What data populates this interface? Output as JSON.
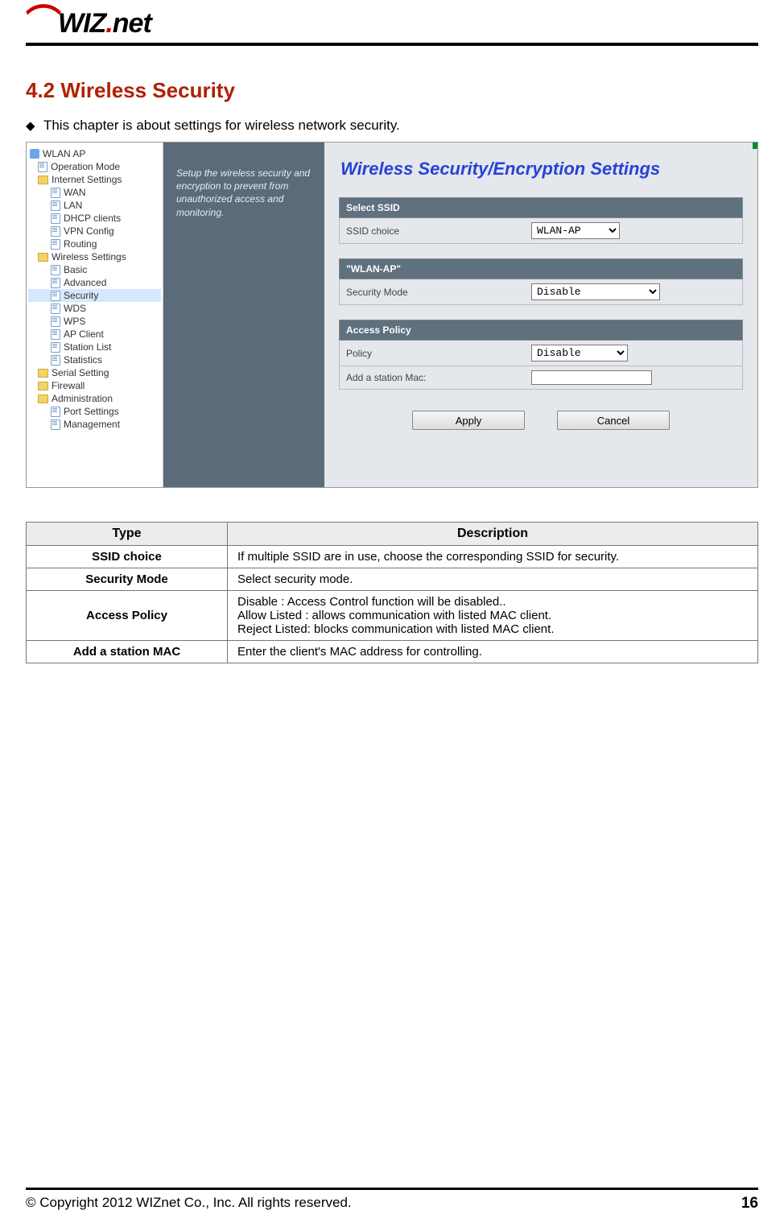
{
  "header": {
    "logo_text_1": "WIZ",
    "logo_text_2": "net"
  },
  "section": {
    "number_title": "4.2  Wireless Security",
    "intro": "This chapter is about settings for wireless network security."
  },
  "screenshot": {
    "tree": {
      "root": "WLAN AP",
      "items": [
        {
          "label": "Operation Mode",
          "indent": 0,
          "icon": "page"
        },
        {
          "label": "Internet Settings",
          "indent": 0,
          "icon": "folder"
        },
        {
          "label": "WAN",
          "indent": 1,
          "icon": "page"
        },
        {
          "label": "LAN",
          "indent": 1,
          "icon": "page"
        },
        {
          "label": "DHCP clients",
          "indent": 1,
          "icon": "page"
        },
        {
          "label": "VPN Config",
          "indent": 1,
          "icon": "page"
        },
        {
          "label": "Routing",
          "indent": 1,
          "icon": "page"
        },
        {
          "label": "Wireless Settings",
          "indent": 0,
          "icon": "folder"
        },
        {
          "label": "Basic",
          "indent": 1,
          "icon": "page"
        },
        {
          "label": "Advanced",
          "indent": 1,
          "icon": "page"
        },
        {
          "label": "Security",
          "indent": 1,
          "icon": "page",
          "selected": true
        },
        {
          "label": "WDS",
          "indent": 1,
          "icon": "page"
        },
        {
          "label": "WPS",
          "indent": 1,
          "icon": "page"
        },
        {
          "label": "AP Client",
          "indent": 1,
          "icon": "page"
        },
        {
          "label": "Station List",
          "indent": 1,
          "icon": "page"
        },
        {
          "label": "Statistics",
          "indent": 1,
          "icon": "page"
        },
        {
          "label": "Serial Setting",
          "indent": 0,
          "icon": "folder"
        },
        {
          "label": "Firewall",
          "indent": 0,
          "icon": "folder"
        },
        {
          "label": "Administration",
          "indent": 0,
          "icon": "folder"
        },
        {
          "label": "Port Settings",
          "indent": 1,
          "icon": "page"
        },
        {
          "label": "Management",
          "indent": 1,
          "icon": "page"
        }
      ]
    },
    "side_desc": "Setup the wireless security and encryption to prevent from unauthorized access and monitoring.",
    "panel": {
      "title": "Wireless Security/Encryption Settings",
      "section1_head": "Select SSID",
      "ssid_label": "SSID choice",
      "ssid_value": "WLAN-AP",
      "section2_head": "\"WLAN-AP\"",
      "secmode_label": "Security Mode",
      "secmode_value": "Disable",
      "section3_head": "Access Policy",
      "policy_label": "Policy",
      "policy_value": "Disable",
      "addmac_label": "Add a station Mac:",
      "addmac_value": "",
      "apply_label": "Apply",
      "cancel_label": "Cancel"
    }
  },
  "table": {
    "head_type": "Type",
    "head_desc": "Description",
    "rows": [
      {
        "type": "SSID choice",
        "desc": [
          "If multiple SSID are in use, choose the corresponding SSID for security."
        ]
      },
      {
        "type": "Security Mode",
        "desc": [
          "Select security mode."
        ]
      },
      {
        "type": "Access Policy",
        "desc": [
          "Disable : Access Control function will be disabled..",
          "Allow Listed : allows communication with listed MAC client.",
          "Reject Listed: blocks communication with listed MAC client."
        ]
      },
      {
        "type": "Add a station MAC",
        "desc": [
          "Enter the client's MAC address for controlling."
        ]
      }
    ]
  },
  "footer": {
    "copyright": "© Copyright 2012 WIZnet Co., Inc. All rights reserved.",
    "page": "16"
  }
}
